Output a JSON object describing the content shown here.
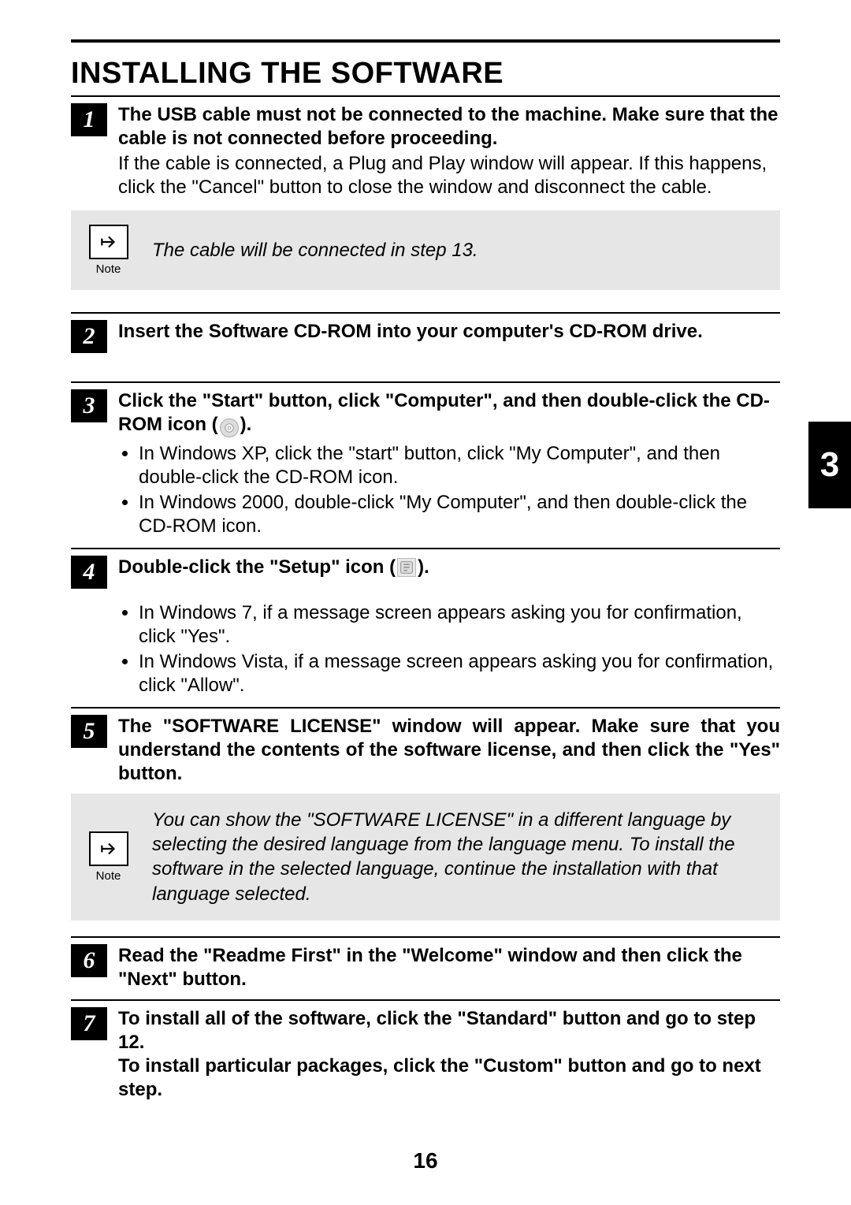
{
  "title": "INSTALLING THE SOFTWARE",
  "chapter_tab": "3",
  "page_number": "16",
  "note_label": "Note",
  "steps": {
    "s1": {
      "num": "1",
      "head": "The USB cable must not be connected to the machine. Make sure that the cable is not connected before proceeding.",
      "sub": "If the cable is connected, a Plug and Play window will appear. If this happens, click the \"Cancel\" button to close the window and disconnect the cable."
    },
    "note1": "The cable will be connected in step 13.",
    "s2": {
      "num": "2",
      "head": "Insert the Software CD-ROM into your computer's CD-ROM drive."
    },
    "s3": {
      "num": "3",
      "head_a": "Click the \"Start\" button, click \"Computer\", and then double-click the CD-ROM icon (",
      "head_b": ").",
      "b1": "In Windows XP, click the \"start\" button, click \"My Computer\", and then double-click the CD-ROM icon.",
      "b2": "In Windows 2000, double-click \"My Computer\", and then double-click the CD-ROM icon."
    },
    "s4": {
      "num": "4",
      "head_a": "Double-click the \"Setup\" icon (",
      "head_b": ").",
      "b1": "In Windows 7, if a message screen appears asking you for confirmation, click \"Yes\".",
      "b2": "In Windows Vista, if a message screen appears asking you for confirmation, click \"Allow\"."
    },
    "s5": {
      "num": "5",
      "head": "The \"SOFTWARE LICENSE\" window will appear. Make sure that you understand the contents of the software license, and then click the \"Yes\" button."
    },
    "note2": "You can show the \"SOFTWARE LICENSE\" in a different language by selecting the desired language from the language menu. To install the software in the selected language, continue the installation with that language selected.",
    "s6": {
      "num": "6",
      "head": "Read the \"Readme First\" in the \"Welcome\" window and then click the \"Next\" button."
    },
    "s7": {
      "num": "7",
      "head": "To install all of the software, click the \"Standard\" button and go to step 12.\nTo install particular packages, click the \"Custom\" button and go to next step."
    }
  }
}
